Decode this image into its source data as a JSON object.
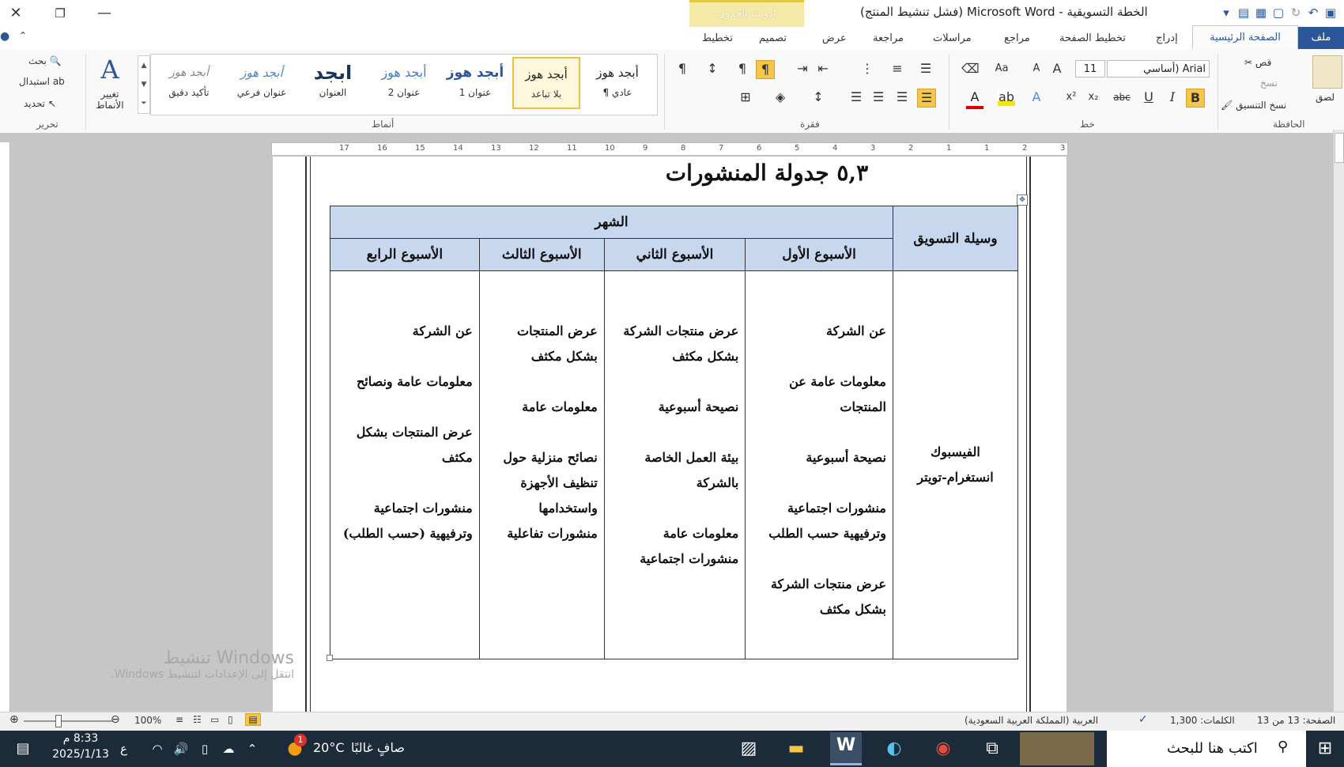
{
  "window": {
    "title": "الخطة التسويقية  -  Microsoft Word (فشل تنشيط المنتج)",
    "contextual_tab": "أدوات الجدول",
    "minimize": "—",
    "restore": "❐",
    "close": "✕"
  },
  "tabs": {
    "file": "ملف",
    "home": "الصفحة الرئيسية",
    "insert": "إدراج",
    "layout": "تخطيط الصفحة",
    "references": "مراجع",
    "mailings": "مراسلات",
    "review": "مراجعة",
    "view": "عرض",
    "design": "تصميم",
    "table_layout": "تخطيط"
  },
  "ribbon": {
    "clipboard": {
      "group": "الحافظة",
      "paste": "لصق",
      "cut": "قص",
      "copy": "نسخ",
      "format_painter": "نسخ التنسيق"
    },
    "font": {
      "group": "خط",
      "font_name": "Arial (أساسي",
      "font_size": "11",
      "bold": "B",
      "italic": "I",
      "underline": "U",
      "strike": "abc",
      "subscript": "x₂",
      "superscript": "x²"
    },
    "paragraph": {
      "group": "فقرة"
    },
    "styles": {
      "group": "أنماط",
      "change_styles": "تغيير الأنماط",
      "items": [
        {
          "preview": "أبجد هوز",
          "caption": "¶ عادي"
        },
        {
          "preview": "أبجد هوز",
          "caption": "بلا تباعد"
        },
        {
          "preview": "أبجد هوز",
          "caption": "عنوان 1"
        },
        {
          "preview": "أبجد هوز",
          "caption": "عنوان 2"
        },
        {
          "preview": "ابجد",
          "caption": "العنوان"
        },
        {
          "preview": "أبجد هوز",
          "caption": "عنوان فرعي"
        },
        {
          "preview": "أبجد هوز",
          "caption": "تأكيد دقيق"
        }
      ]
    },
    "editing": {
      "group": "تحرير",
      "find": "بحث",
      "replace": "استبدال",
      "select": "تحديد"
    }
  },
  "ruler": [
    "3",
    "2",
    "1",
    "1",
    "2",
    "3",
    "4",
    "5",
    "6",
    "7",
    "8",
    "9",
    "10",
    "11",
    "12",
    "13",
    "14",
    "15",
    "16",
    "17"
  ],
  "document": {
    "heading": "٥,٣ جدولة المنشورات",
    "table": {
      "col_channel": "وسيلة التسويق",
      "col_month": "الشهر",
      "weeks": [
        "الأسبوع الأول",
        "الأسبوع الثاني",
        "الأسبوع الثالث",
        "الأسبوع الرابع"
      ],
      "channel": "الفيسبوك انستغرام-تويتر",
      "week1": [
        "عن الشركة",
        "معلومات عامة عن المنتجات",
        "نصيحة أسبوعية",
        "منشورات اجتماعية وترفيهية حسب الطلب",
        "عرض منتجات الشركة بشكل مكثف"
      ],
      "week2": [
        "عرض منتجات الشركة بشكل مكثف",
        "نصيحة أسبوعية",
        "بيئة العمل الخاصة بالشركة",
        "معلومات عامة",
        "منشورات اجتماعية"
      ],
      "week3": [
        "عرض المنتجات بشكل مكثف",
        "معلومات عامة",
        "نصائح منزلية حول تنظيف الأجهزة واستخدامها",
        "منشورات تفاعلية"
      ],
      "week4": [
        "عن الشركة",
        "معلومات عامة ونصائح",
        "عرض المنتجات بشكل مكثف",
        "منشورات اجتماعية وترفيهية (حسب الطلب)"
      ]
    },
    "watermark_title": "تنشيط Windows",
    "watermark_sub": "انتقل إلى الإعدادات لتنشيط Windows."
  },
  "statusbar": {
    "page": "الصفحة: 13 من 13",
    "words": "الكلمات: 1,300",
    "language": "العربية (المملكة العربية السعودية)",
    "zoom": "100%"
  },
  "taskbar": {
    "search_placeholder": "اكتب هنا للبحث",
    "weather_temp": "20°C",
    "weather_text": "صافٍ غالبًا",
    "time": "8:33 م",
    "date": "2025/1/13",
    "input_lang": "ع",
    "notification_count": "1"
  },
  "colors": {
    "accent": "#2b579a",
    "table_header": "#c7d7ee",
    "taskbar": "#1c2b3a"
  }
}
